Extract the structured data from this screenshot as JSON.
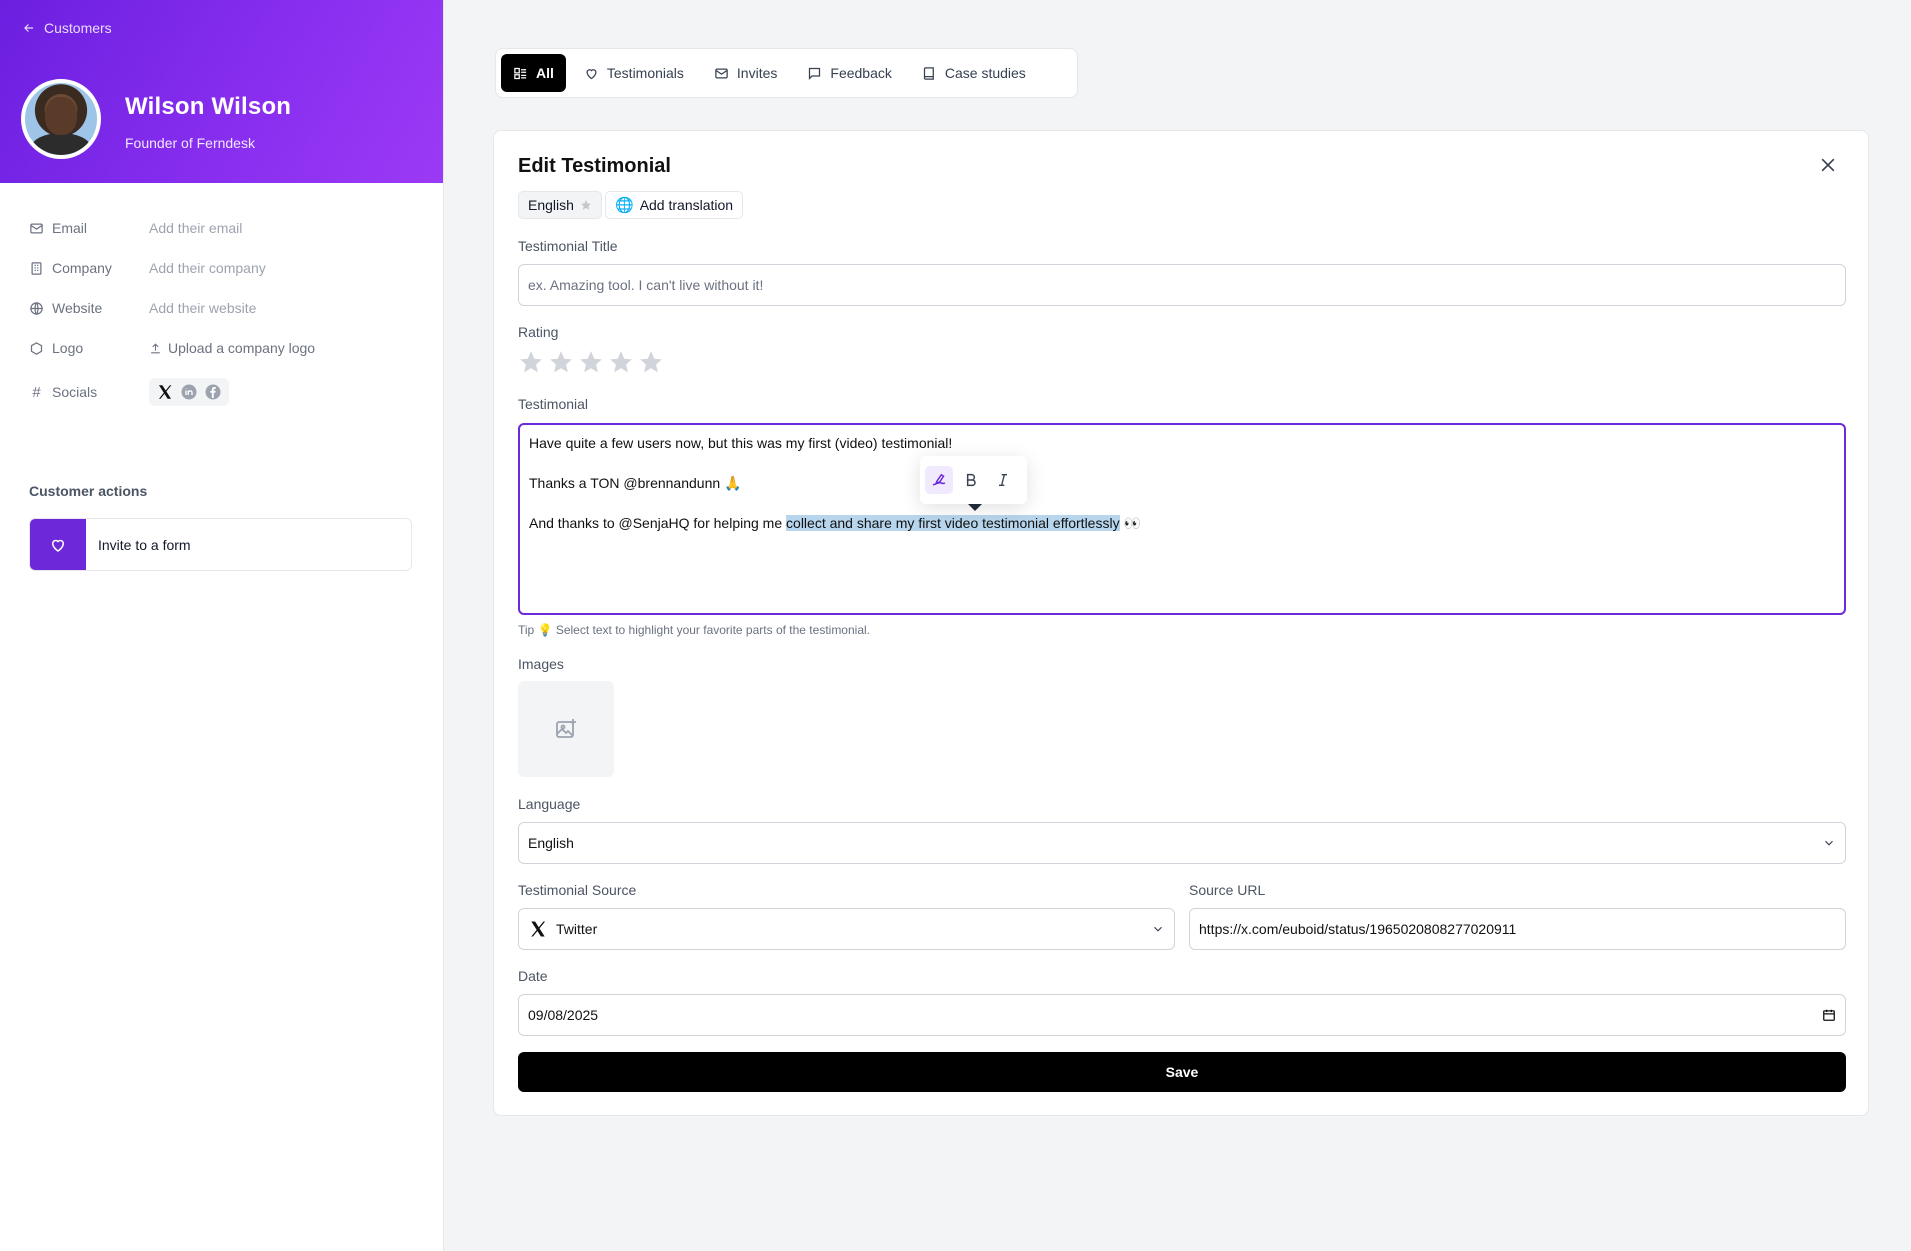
{
  "sidebar": {
    "back_label": "Customers",
    "name": "Wilson Wilson",
    "role": "Founder of Ferndesk",
    "fields": {
      "email_label": "Email",
      "email_value": "Add their email",
      "company_label": "Company",
      "company_value": "Add their company",
      "website_label": "Website",
      "website_value": "Add their website",
      "logo_label": "Logo",
      "logo_value": "Upload a company logo",
      "socials_label": "Socials"
    },
    "actions_title": "Customer actions",
    "invite_label": "Invite to a form",
    "accent_color": "#6d28d9"
  },
  "tabs": [
    {
      "label": "All",
      "icon": "list-icon",
      "active": true
    },
    {
      "label": "Testimonials",
      "icon": "heart-icon"
    },
    {
      "label": "Invites",
      "icon": "mail-icon"
    },
    {
      "label": "Feedback",
      "icon": "message-icon"
    },
    {
      "label": "Case studies",
      "icon": "book-icon"
    }
  ],
  "form": {
    "title": "Edit Testimonial",
    "language_chip": "English",
    "add_translation": "Add translation",
    "title_label": "Testimonial Title",
    "title_placeholder": "ex. Amazing tool. I can't live without it!",
    "rating_label": "Rating",
    "rating_value": 0,
    "rating_max": 5,
    "testimonial_label": "Testimonial",
    "testimonial": {
      "line1": "Have quite a few users now, but this was my first (video) testimonial!",
      "line2": "Thanks a TON @brennandunn 🙏",
      "line3_before": "And thanks to @SenjaHQ for helping me ",
      "line3_highlight": "collect and share my first video testimonial effortlessly",
      "line3_after": " 👀"
    },
    "tip": "Tip 💡 Select text to highlight your favorite parts of the testimonial.",
    "images_label": "Images",
    "language_label": "Language",
    "language_value": "English",
    "source_label": "Testimonial Source",
    "source_value": "Twitter",
    "url_label": "Source URL",
    "url_value": "https://x.com/euboid/status/1965020808277020911",
    "date_label": "Date",
    "date_value": "09/08/2025",
    "save_label": "Save"
  }
}
